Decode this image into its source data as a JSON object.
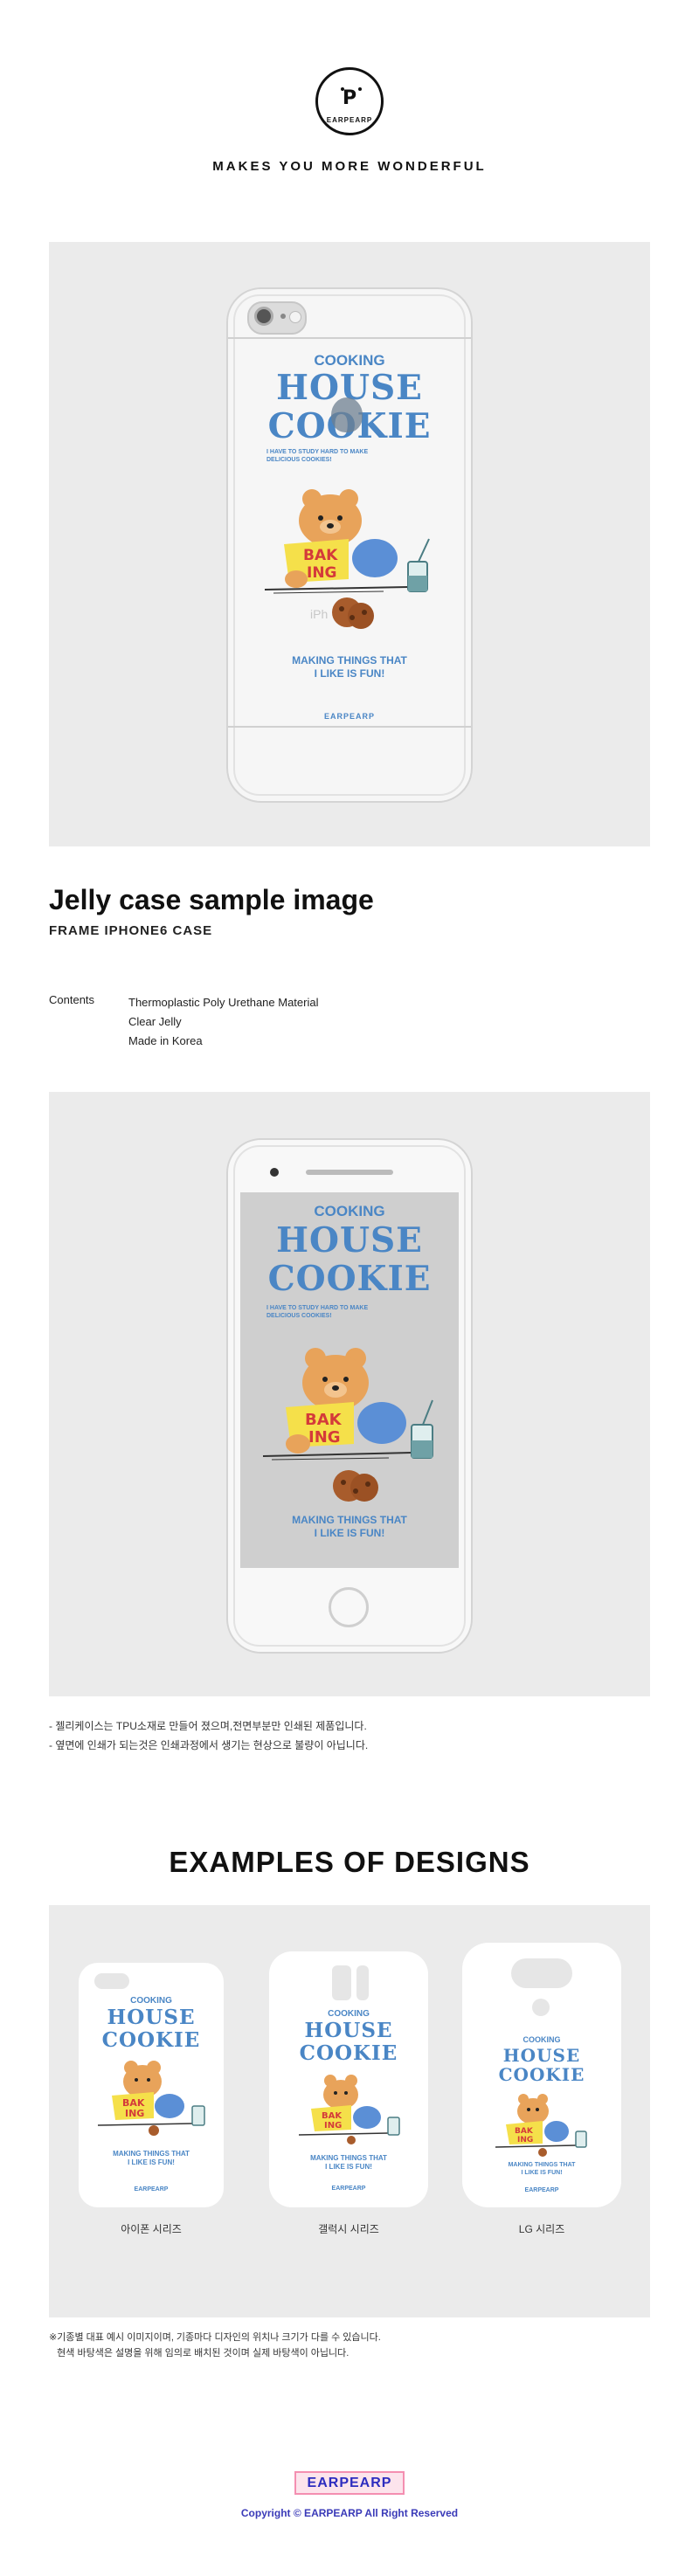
{
  "brand": {
    "logo_letter": "P",
    "logo_ring_text": "EARPEARP",
    "tagline": "MAKES YOU MORE WONDERFUL"
  },
  "design": {
    "cooking": "COOKING",
    "house": "HOUSE",
    "cookie": "COOKIE",
    "small_line1": "I HAVE TO STUDY HARD TO MAKE",
    "small_line2": "DELICIOUS COOKIES!",
    "baking_top": "BAK",
    "baking_bottom": "ING",
    "making1": "MAKING THINGS THAT",
    "making2": "I LIKE IS FUN!",
    "case_brand": "EARPEARP",
    "phone_engraving": "iPh"
  },
  "section1": {
    "title": "Jelly case sample image",
    "subtitle": "FRAME IPHONE6 CASE",
    "contents_label": "Contents",
    "contents": [
      "Thermoplastic Poly Urethane Material",
      "Clear Jelly",
      "Made in Korea"
    ]
  },
  "notes": [
    "- 젤리케이스는 TPU소재로 만들어 졌으며,전면부분만 인쇄된 제품입니다.",
    "- 옆면에 인쇄가 되는것은 인쇄과정에서 생기는 현상으로 불량이 아닙니다."
  ],
  "examples": {
    "title": "EXAMPLES OF DESIGNS",
    "labels": [
      "아이폰 시리즈",
      "갤럭시 시리즈",
      "LG 시리즈"
    ]
  },
  "footnotes": [
    "※기종별 대표 예시 이미지이며, 기종마다 디자인의 위치나 크기가 다를 수 있습니다.",
    "   현색 바탕색은 설명을 위해 임의로 배치된 것이며 실제 바탕색이 아닙니다."
  ],
  "footer": {
    "brand": "EARPEARP",
    "copyright": "Copyright © EARPEARP All Right Reserved"
  },
  "colors": {
    "design_blue": "#4a86c5",
    "bear_orange": "#e8a35a",
    "book_yellow": "#f5e04a",
    "sweater_blue": "#5b8fd6",
    "panel_gray": "#ebebeb",
    "footer_text": "#3a3ab8",
    "footer_box_border": "#f48fb1"
  }
}
